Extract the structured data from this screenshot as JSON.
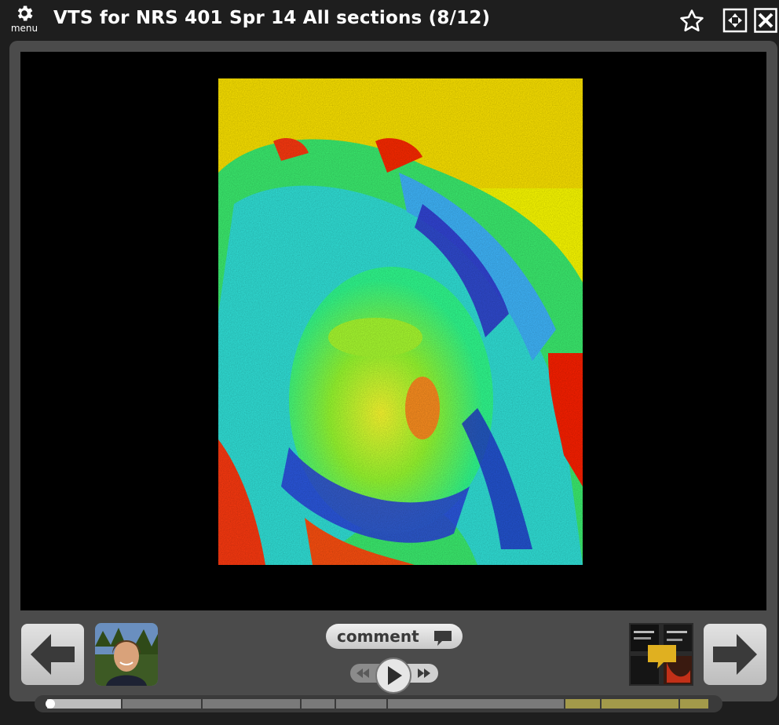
{
  "header": {
    "menu_label": "menu",
    "title": "VTS for NRS 401 Spr 14 All sections (8/12)"
  },
  "icons": {
    "menu": "gear-icon",
    "favorite": "star-icon",
    "fit": "fit-screen-icon",
    "close": "close-icon"
  },
  "player": {
    "comment_label": "comment",
    "current_slide": 8,
    "total_slides": 12,
    "progress_segments": 12
  },
  "colors": {
    "background": "#1e1e1e",
    "frame": "#4b4b4b",
    "stage": "#000000",
    "button_light": "#d8d8d8"
  }
}
